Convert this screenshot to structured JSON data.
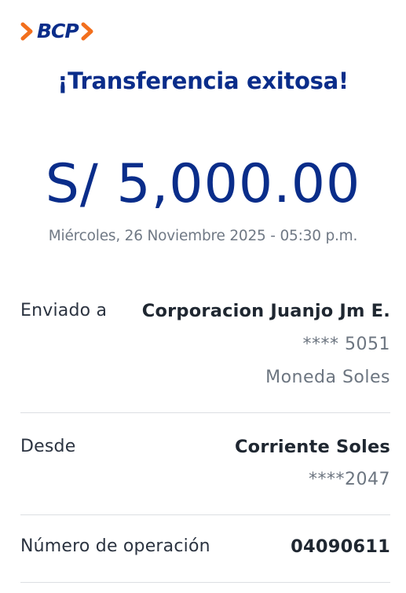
{
  "brand": {
    "name": "BCP",
    "colors": {
      "primary": "#0a2d8a",
      "accent": "#f26f1d"
    }
  },
  "title": "¡Transferencia exitosa!",
  "amount": "S/ 5,000.00",
  "datetime": "Miércoles, 26 Noviembre 2025 - 05:30 p.m.",
  "sent_to": {
    "label": "Enviado a",
    "name": "Corporacion Juanjo Jm E.",
    "account": "**** 5051",
    "currency": "Moneda Soles"
  },
  "from": {
    "label": "Desde",
    "account_name": "Corriente Soles",
    "account": "****2047"
  },
  "operation": {
    "label": "Número de operación",
    "number": "04090611"
  }
}
